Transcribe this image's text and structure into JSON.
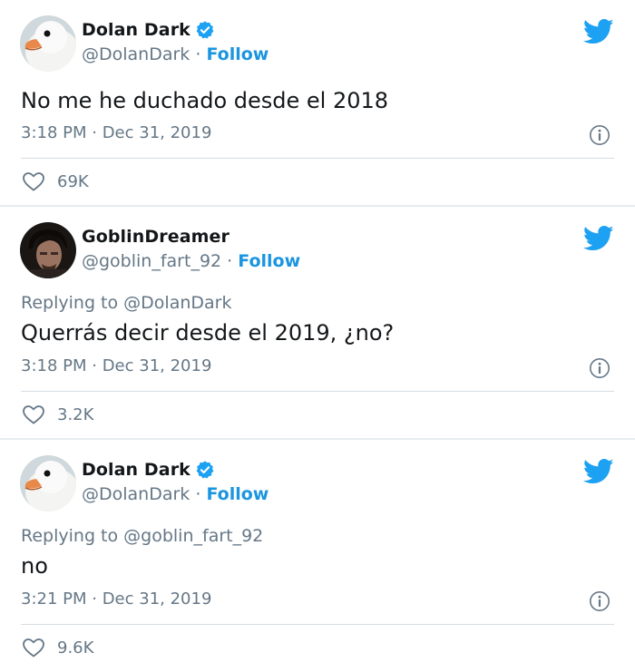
{
  "tweets": [
    {
      "name": "Dolan Dark",
      "handle": "@DolanDark",
      "follow_label": "Follow",
      "separator": " · ",
      "verified": true,
      "replying_to": "",
      "text": "No me he duchado desde el 2018",
      "time": "3:18 PM · Dec 31, 2019",
      "likes": "69K",
      "avatar": "goose-avatar"
    },
    {
      "name": "GoblinDreamer",
      "handle": "@goblin_fart_92",
      "follow_label": "Follow",
      "separator": " · ",
      "verified": false,
      "replying_to": "Replying to @DolanDark",
      "text": "Querrás decir desde el 2019, ¿no?",
      "time": "3:18 PM · Dec 31, 2019",
      "likes": "3.2K",
      "avatar": "person-avatar"
    },
    {
      "name": "Dolan Dark",
      "handle": "@DolanDark",
      "follow_label": "Follow",
      "separator": " · ",
      "verified": true,
      "replying_to": "Replying to @goblin_fart_92",
      "text": "no",
      "time": "3:21 PM · Dec 31, 2019",
      "likes": "9.6K",
      "avatar": "goose-avatar"
    }
  ],
  "colors": {
    "accent": "#1b95e0",
    "twitter_bird": "#1da1f2",
    "muted_text": "#657786",
    "separator": "#e6ecf0"
  },
  "icons": [
    "twitter-bird-icon",
    "verified-badge-icon",
    "info-icon",
    "heart-icon"
  ]
}
